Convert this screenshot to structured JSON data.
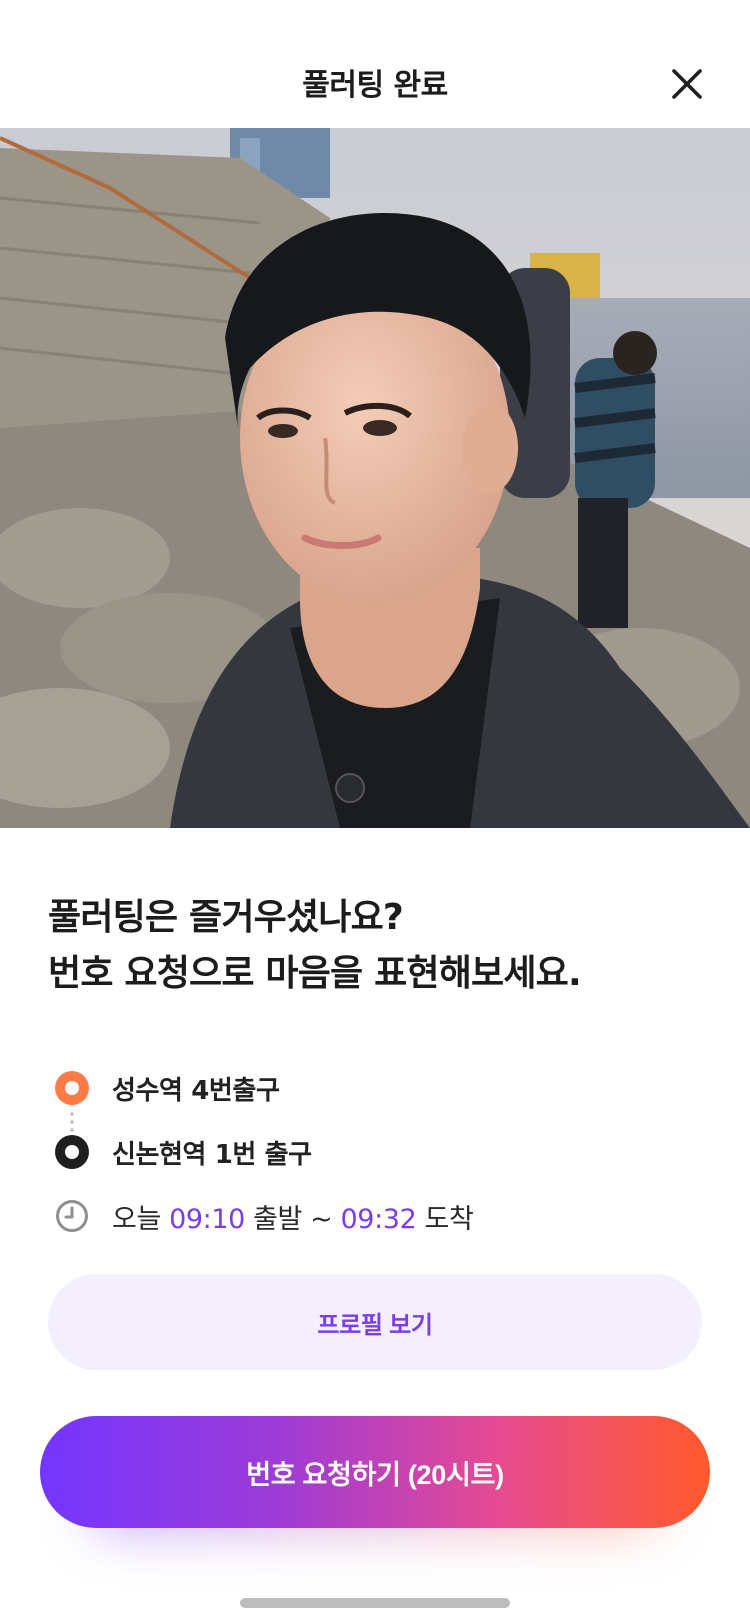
{
  "header": {
    "title": "풀러팅 완료"
  },
  "headline": {
    "line1": "풀러팅은 즐거우셨나요?",
    "line2": "번호 요청으로 마음을 표현해보세요."
  },
  "route": {
    "start": "성수역 4번출구",
    "end": "신논현역 1번 출구",
    "time": {
      "prefix": "오늘 ",
      "depart_time": "09:10",
      "depart_label": " 출발 ~ ",
      "arrive_time": "09:32",
      "arrive_label": " 도착"
    }
  },
  "buttons": {
    "profile": "프로필 보기",
    "request": "번호 요청하기 (20시트)"
  },
  "colors": {
    "accent": "#7a3cf0",
    "start_dot": "#ff7a45",
    "gradient_start": "#7436ff",
    "gradient_end": "#ff5a2a"
  }
}
